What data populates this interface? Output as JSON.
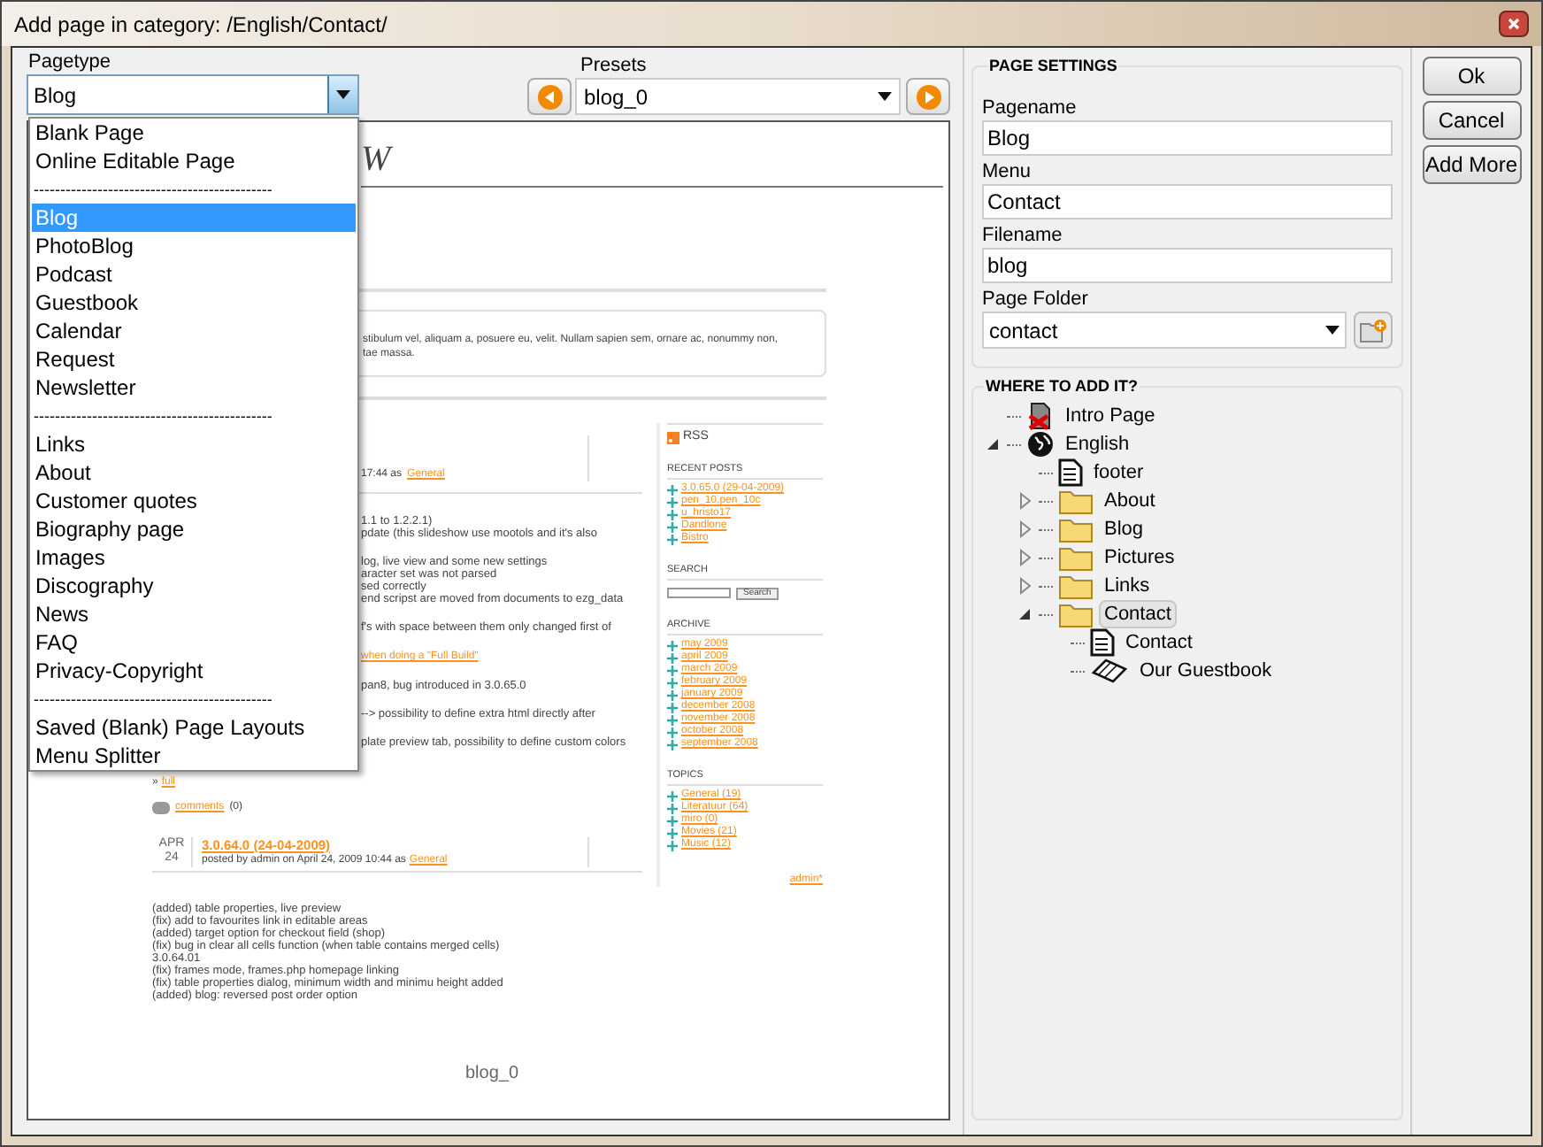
{
  "window": {
    "title": "Add page in category: /English/Contact/"
  },
  "pagetype": {
    "label": "Pagetype",
    "value": "Blog",
    "expanded": true,
    "options": [
      {
        "kind": "item",
        "text": "Blank Page",
        "selected": false
      },
      {
        "kind": "item",
        "text": "Online Editable Page",
        "selected": false
      },
      {
        "kind": "separator",
        "text": "---------------------------------------------"
      },
      {
        "kind": "item",
        "text": "Blog",
        "selected": true
      },
      {
        "kind": "item",
        "text": "PhotoBlog",
        "selected": false
      },
      {
        "kind": "item",
        "text": "Podcast",
        "selected": false
      },
      {
        "kind": "item",
        "text": "Guestbook",
        "selected": false
      },
      {
        "kind": "item",
        "text": "Calendar",
        "selected": false
      },
      {
        "kind": "item",
        "text": "Request",
        "selected": false
      },
      {
        "kind": "item",
        "text": "Newsletter",
        "selected": false
      },
      {
        "kind": "separator",
        "text": "---------------------------------------------"
      },
      {
        "kind": "item",
        "text": "Links",
        "selected": false
      },
      {
        "kind": "item",
        "text": "About",
        "selected": false
      },
      {
        "kind": "item",
        "text": "Customer quotes",
        "selected": false
      },
      {
        "kind": "item",
        "text": "Biography page",
        "selected": false
      },
      {
        "kind": "item",
        "text": "Images",
        "selected": false
      },
      {
        "kind": "item",
        "text": "Discography",
        "selected": false
      },
      {
        "kind": "item",
        "text": "News",
        "selected": false
      },
      {
        "kind": "item",
        "text": "FAQ",
        "selected": false
      },
      {
        "kind": "item",
        "text": "Privacy-Copyright",
        "selected": false
      },
      {
        "kind": "separator",
        "text": "---------------------------------------------"
      },
      {
        "kind": "item",
        "text": "Saved (Blank) Page Layouts",
        "selected": false
      },
      {
        "kind": "item",
        "text": "Menu Splitter",
        "selected": false
      }
    ]
  },
  "presets": {
    "label": "Presets",
    "value": "blog_0"
  },
  "preview": {
    "heading": "W",
    "intro_lines": [
      "stibulum vel, aliquam a, posuere eu, velit. Nullam sapien sem, ornare ac, nonummy non,",
      "tae massa."
    ],
    "post_1": {
      "meta": "17:44 as",
      "category": "General",
      "lines": [
        {
          "kind": "text",
          "spaced": false,
          "text": "1.1 to 1.2.2.1)"
        },
        {
          "kind": "text",
          "spaced": false,
          "text": "pdate (this slideshow use mootols and it's also"
        },
        {
          "kind": "text",
          "spaced": true,
          "text": "log, live view and some new settings"
        },
        {
          "kind": "text",
          "spaced": false,
          "text": "aracter set was not parsed"
        },
        {
          "kind": "text",
          "spaced": false,
          "text": "sed correctly"
        },
        {
          "kind": "text",
          "spaced": false,
          "text": "end scripst are moved from documents to ezg_data"
        },
        {
          "kind": "text",
          "spaced": true,
          "text": "f's with space between them only changed first of"
        },
        {
          "kind": "link",
          "spaced": true,
          "text": "when doing a \"Full Build\""
        },
        {
          "kind": "text",
          "spaced": true,
          "text": "pan8, bug introduced in 3.0.65.0"
        },
        {
          "kind": "text",
          "spaced": true,
          "text": "--> possibility to define extra html directly after"
        },
        {
          "kind": "text",
          "spaced": true,
          "text": "plate preview tab, possibility to define custom colors"
        }
      ],
      "more_arrow": "»",
      "more": "full",
      "comments": "comments",
      "comment_count": "(0)"
    },
    "post_2": {
      "month": "APR",
      "day": "24",
      "title": "3.0.64.0 (24-04-2009)",
      "meta": "posted by admin on April 24, 2009 10:44 as",
      "category": "General",
      "lines": [
        "(added) table properties, live preview",
        "(fix) add to favourites link in editable areas",
        "(added) target option for checkout field (shop)",
        "(fix) bug in clear all cells function (when table contains merged cells)",
        "3.0.64.01",
        "(fix) frames mode, frames.php homepage linking",
        "(fix) table properties dialog, minimum width and minimu height added",
        "(added) blog: reversed post order option"
      ]
    },
    "sidebar": {
      "rss": "RSS",
      "sections": [
        {
          "kind": "links",
          "title": "RECENT POSTS",
          "links": [
            "3.0.65.0 (29-04-2009)",
            "pen_10,pen_10c",
            "u_hristo17",
            "Dandlone",
            "Bistro"
          ]
        },
        {
          "kind": "search",
          "title": "SEARCH",
          "button": "Search"
        },
        {
          "kind": "links",
          "title": "ARCHIVE",
          "links": [
            "may 2009",
            "april 2009",
            "march 2009",
            "february 2009",
            "january 2009",
            "december 2008",
            "november 2008",
            "october 2008",
            "september 2008"
          ]
        },
        {
          "kind": "links",
          "title": "TOPICS",
          "links": [
            "General (19)",
            "Literatuur (64)",
            "miro (0)",
            "Movies (21)",
            "Music (12)"
          ]
        }
      ],
      "footer": "admin*"
    },
    "caption": "blog_0"
  },
  "page_settings": {
    "title": "PAGE SETTINGS",
    "fields": [
      {
        "label": "Pagename",
        "value": "Blog"
      },
      {
        "label": "Menu",
        "value": "Contact"
      },
      {
        "label": "Filename",
        "value": "blog"
      }
    ],
    "folder": {
      "label": "Page Folder",
      "value": "contact"
    }
  },
  "where": {
    "title": "WHERE TO ADD IT?",
    "tree": [
      {
        "kind": "intro",
        "label": "Intro Page",
        "selected": false
      },
      {
        "kind": "language",
        "label": "English",
        "selected": false,
        "expanded": true,
        "children": [
          {
            "kind": "page",
            "label": "footer",
            "selected": false
          },
          {
            "kind": "folder",
            "label": "About",
            "selected": false,
            "expanded": false
          },
          {
            "kind": "folder",
            "label": "Blog",
            "selected": false,
            "expanded": false
          },
          {
            "kind": "folder",
            "label": "Pictures",
            "selected": false,
            "expanded": false
          },
          {
            "kind": "folder",
            "label": "Links",
            "selected": false,
            "expanded": false
          },
          {
            "kind": "folder",
            "label": "Contact",
            "selected": true,
            "expanded": true,
            "children": [
              {
                "kind": "page",
                "label": "Contact",
                "selected": false
              },
              {
                "kind": "guestbook",
                "label": "Our Guestbook",
                "selected": false
              }
            ]
          }
        ]
      }
    ]
  },
  "buttons": [
    "Ok",
    "Cancel",
    "Add More"
  ]
}
